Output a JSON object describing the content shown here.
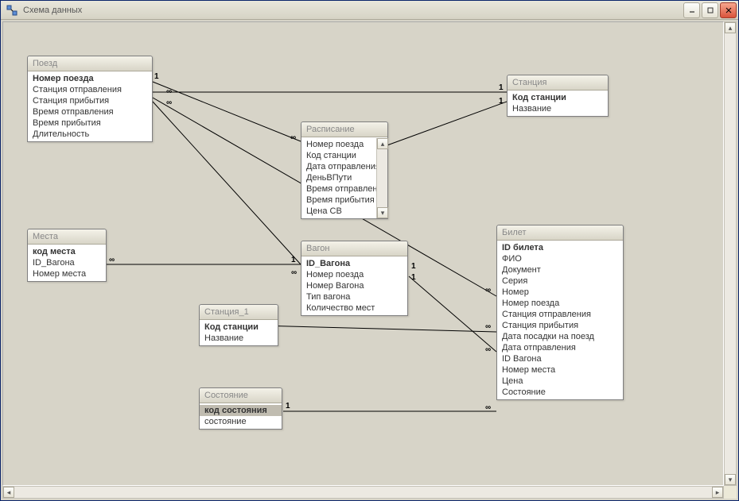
{
  "window": {
    "title": "Схема данных"
  },
  "tables": {
    "poezd": {
      "title": "Поезд",
      "fields": [
        "Номер поезда",
        "Станция отправления",
        "Станция прибытия",
        "Время отправления",
        "Время прибытия",
        "Длительность"
      ]
    },
    "stanciya": {
      "title": "Станция",
      "fields": [
        "Код станции",
        "Название"
      ]
    },
    "raspisanie": {
      "title": "Расписание",
      "fields": [
        "Номер поезда",
        "Код станции",
        "Дата отправления",
        "ДеньВПути",
        "Время отправления",
        "Время прибытия",
        "Цена СВ"
      ]
    },
    "mesta": {
      "title": "Места",
      "fields": [
        "код места",
        "ID_Вагона",
        "Номер места"
      ]
    },
    "vagon": {
      "title": "Вагон",
      "fields": [
        "ID_Вагона",
        "Номер поезда",
        "Номер Вагона",
        "Тип вагона",
        "Количество мест"
      ]
    },
    "bilet": {
      "title": "Билет",
      "fields": [
        "ID билета",
        "ФИО",
        "Документ",
        "Серия",
        "Номер",
        "Номер поезда",
        "Станция отправления",
        "Станция прибытия",
        "Дата посадки на поезд",
        "Дата отправления",
        "ID Вагона",
        "Номер места",
        "Цена",
        "Состояние"
      ]
    },
    "stanciya1": {
      "title": "Станция_1",
      "fields": [
        "Код станции",
        "Название"
      ]
    },
    "sostoyanie": {
      "title": "Состояние",
      "fields": [
        "код состояния",
        "состояние"
      ]
    }
  },
  "cardinality": {
    "one": "1",
    "many": "∞"
  }
}
